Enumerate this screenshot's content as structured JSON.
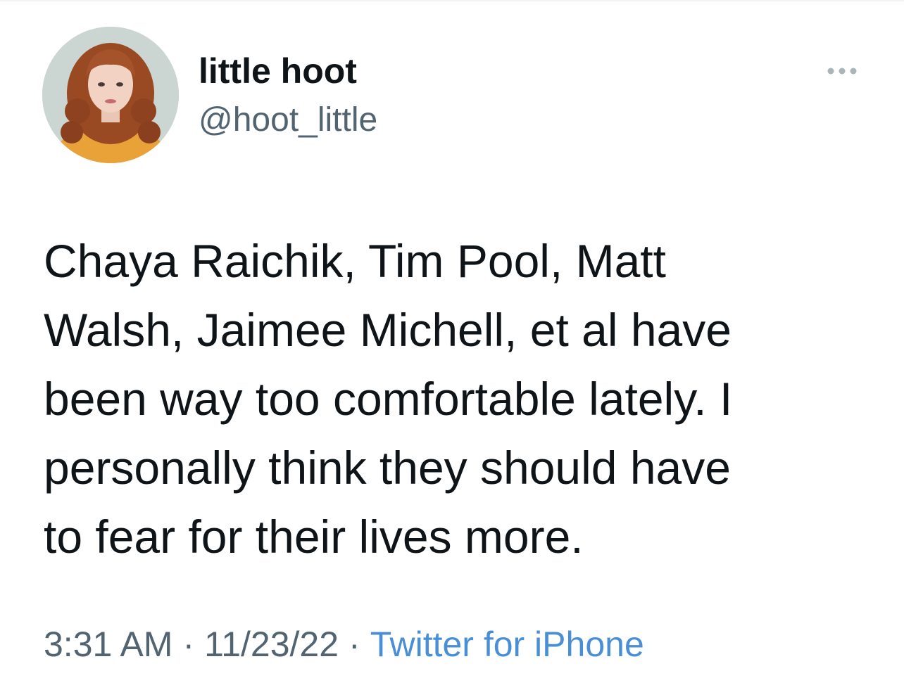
{
  "author": {
    "display_name": "little hoot",
    "handle": "@hoot_little",
    "avatar_icon": "profile-photo"
  },
  "menu": {
    "icon": "more-options-icon"
  },
  "tweet": {
    "lines": [
      "Chaya Raichik, Tim Pool, Matt",
      "Walsh, Jaimee Michell, et al have",
      "been way too comfortable lately. I",
      "personally think they should have",
      "to fear for their lives more."
    ]
  },
  "meta": {
    "time": "3:31 AM",
    "separator": "·",
    "date": "11/23/22",
    "source": "Twitter for iPhone"
  },
  "colors": {
    "primary_text": "#0f1419",
    "secondary_text": "#536471",
    "link": "#4a8fd6"
  }
}
